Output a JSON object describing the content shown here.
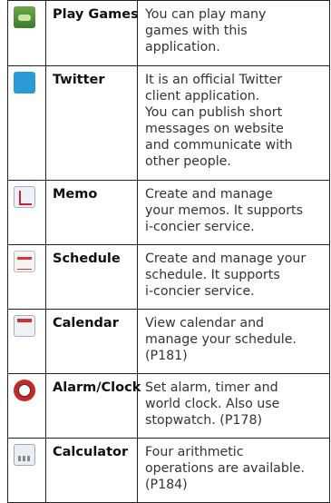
{
  "rows": [
    {
      "icon": "play-games-icon",
      "name": "Play Games",
      "description": "You can play many\ngames with this\napplication."
    },
    {
      "icon": "twitter-bird-icon",
      "name": "Twitter",
      "description": "It is an official Twitter\nclient application.\nYou can publish short\nmessages on website\nand communicate with\nother people."
    },
    {
      "icon": "memo-pad-icon",
      "name": "Memo",
      "description": "Create and manage\nyour memos. It supports\ni-concier service."
    },
    {
      "icon": "schedule-icon",
      "name": "Schedule",
      "description": "Create and manage your\nschedule. It supports\ni-concier service."
    },
    {
      "icon": "calendar-icon",
      "name": "Calendar",
      "description": "View calendar and\nmanage your schedule.\n(P181)"
    },
    {
      "icon": "alarm-clock-icon",
      "name": "Alarm/Clock",
      "description": "Set alarm, timer and\nworld clock. Also use\nstopwatch. (P178)"
    },
    {
      "icon": "calculator-icon",
      "name": "Calculator",
      "description": "Four arithmetic\noperations are available.\n(P184)"
    }
  ]
}
